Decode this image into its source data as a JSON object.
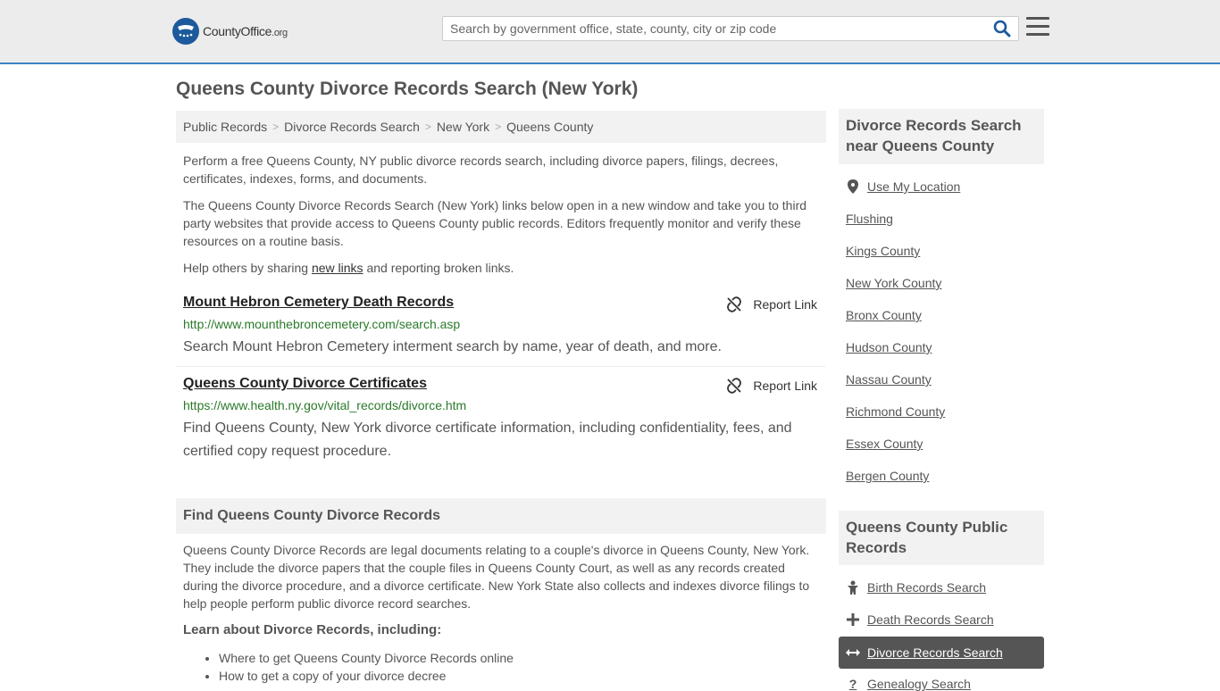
{
  "header": {
    "logo_text": "CountyOffice",
    "logo_suffix": ".org",
    "search_placeholder": "Search by government office, state, county, city or zip code"
  },
  "page": {
    "title": "Queens County Divorce Records Search (New York)"
  },
  "breadcrumb": [
    "Public Records",
    "Divorce Records Search",
    "New York",
    "Queens County"
  ],
  "intro": {
    "p1": "Perform a free Queens County, NY public divorce records search, including divorce papers, filings, decrees, certificates, indexes, forms, and documents.",
    "p2": "The Queens County Divorce Records Search (New York) links below open in a new window and take you to third party websites that provide access to Queens County public records. Editors frequently monitor and verify these resources on a routine basis.",
    "p3_before": "Help others by sharing ",
    "p3_link": "new links",
    "p3_after": " and reporting broken links."
  },
  "results": [
    {
      "title": "Mount Hebron Cemetery Death Records",
      "report_label": "Report Link",
      "url": "http://www.mounthebroncemetery.com/search.asp",
      "description": "Search Mount Hebron Cemetery interment search by name, year of death, and more."
    },
    {
      "title": "Queens County Divorce Certificates",
      "report_label": "Report Link",
      "url": "https://www.health.ny.gov/vital_records/divorce.htm",
      "description": "Find Queens County, New York divorce certificate information, including confidentiality, fees, and certified copy request procedure."
    }
  ],
  "find_section": {
    "heading": "Find Queens County Divorce Records",
    "body": "Queens County Divorce Records are legal documents relating to a couple's divorce in Queens County, New York. They include the divorce papers that the couple files in Queens County Court, as well as any records created during the divorce procedure, and a divorce certificate. New York State also collects and indexes divorce filings to help people perform public divorce record searches.",
    "learn_heading": "Learn about Divorce Records, including:",
    "learn_items": [
      "Where to get Queens County Divorce Records online",
      "How to get a copy of your divorce decree"
    ]
  },
  "sidebar": {
    "nearby_heading": "Divorce Records Search near Queens County",
    "use_location": "Use My Location",
    "nearby": [
      "Flushing",
      "Kings County",
      "New York County",
      "Bronx County",
      "Hudson County",
      "Nassau County",
      "Richmond County",
      "Essex County",
      "Bergen County"
    ],
    "public_heading": "Queens County Public Records",
    "public_links": [
      {
        "label": "Birth Records Search",
        "icon": "baby-icon"
      },
      {
        "label": "Death Records Search",
        "icon": "cross-icon"
      },
      {
        "label": "Divorce Records Search",
        "icon": "arrows-icon"
      },
      {
        "label": "Genealogy Search",
        "icon": "question-icon"
      }
    ]
  },
  "colors": {
    "accent_blue": "#3f82c4",
    "url_green": "#2a7a2a",
    "active_bg": "#555555"
  }
}
